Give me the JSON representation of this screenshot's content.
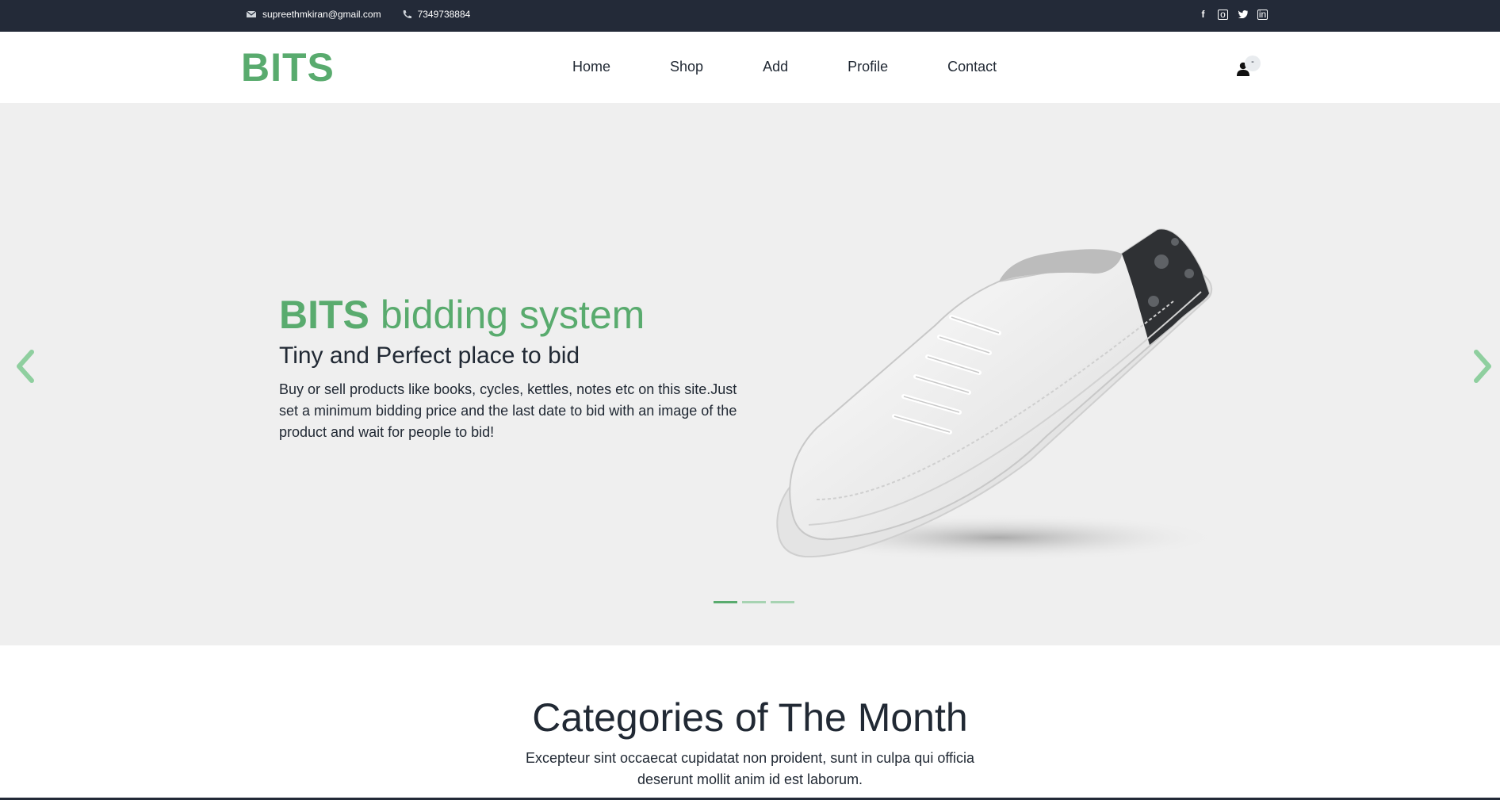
{
  "topbar": {
    "email": "supreethmkiran@gmail.com",
    "phone": "7349738884",
    "icons": {
      "email": "envelope-icon",
      "phone": "phone-icon",
      "social": [
        "facebook-icon",
        "instagram-icon",
        "twitter-icon",
        "linkedin-icon"
      ]
    }
  },
  "header": {
    "logo": "BITS",
    "nav": [
      "Home",
      "Shop",
      "Add",
      "Profile",
      "Contact"
    ],
    "user_badge": "-"
  },
  "hero": {
    "title_strong": "BITS",
    "title_light": "bidding system",
    "subtitle": "Tiny and Perfect place to bid",
    "description": "Buy or sell products like books, cycles, kettles, notes etc on this site.Just set a minimum bidding price and the last date to bid with an image of the product and wait for people to bid!",
    "slides_count": 3,
    "active_slide": 1
  },
  "categories": {
    "title": "Categories of The Month",
    "description": "Excepteur sint occaecat cupidatat non proident, sunt in culpa qui officia deserunt mollit anim id est laborum."
  },
  "colors": {
    "accent": "#59ab6e",
    "topbar_bg": "#232a38",
    "hero_bg": "#efefef",
    "text": "#212934"
  }
}
